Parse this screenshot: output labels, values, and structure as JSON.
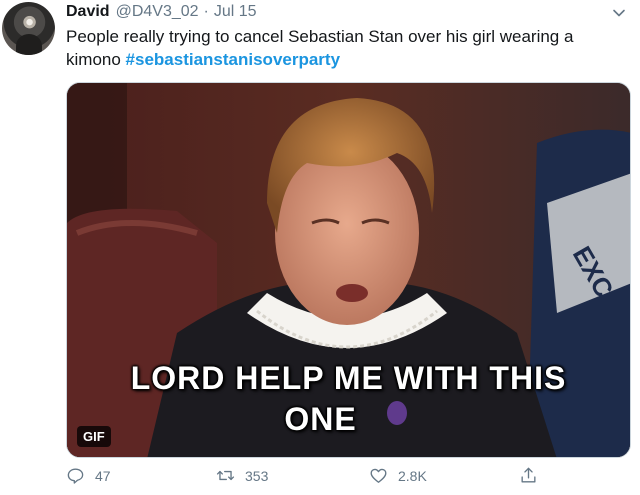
{
  "tweet": {
    "author_name": "David",
    "author_handle": "@D4V3_02",
    "separator": "·",
    "date": "Jul 15",
    "text": "People really trying to cancel Sebastian Stan over his girl wearing a kimono",
    "hashtag": "#sebastianstanisoverparty"
  },
  "media": {
    "caption_line1": "LORD HELP ME WITH THIS",
    "caption_line2": "ONE",
    "badge": "GIF",
    "background_text": "EXC"
  },
  "actions": {
    "reply_count": "47",
    "retweet_count": "353",
    "like_count": "2.8K"
  },
  "icons": [
    "chevron-down-icon",
    "reply-icon",
    "retweet-icon",
    "like-icon",
    "share-icon"
  ],
  "colors": {
    "text": "#14171a",
    "secondary": "#657786",
    "link": "#1b95e0"
  }
}
